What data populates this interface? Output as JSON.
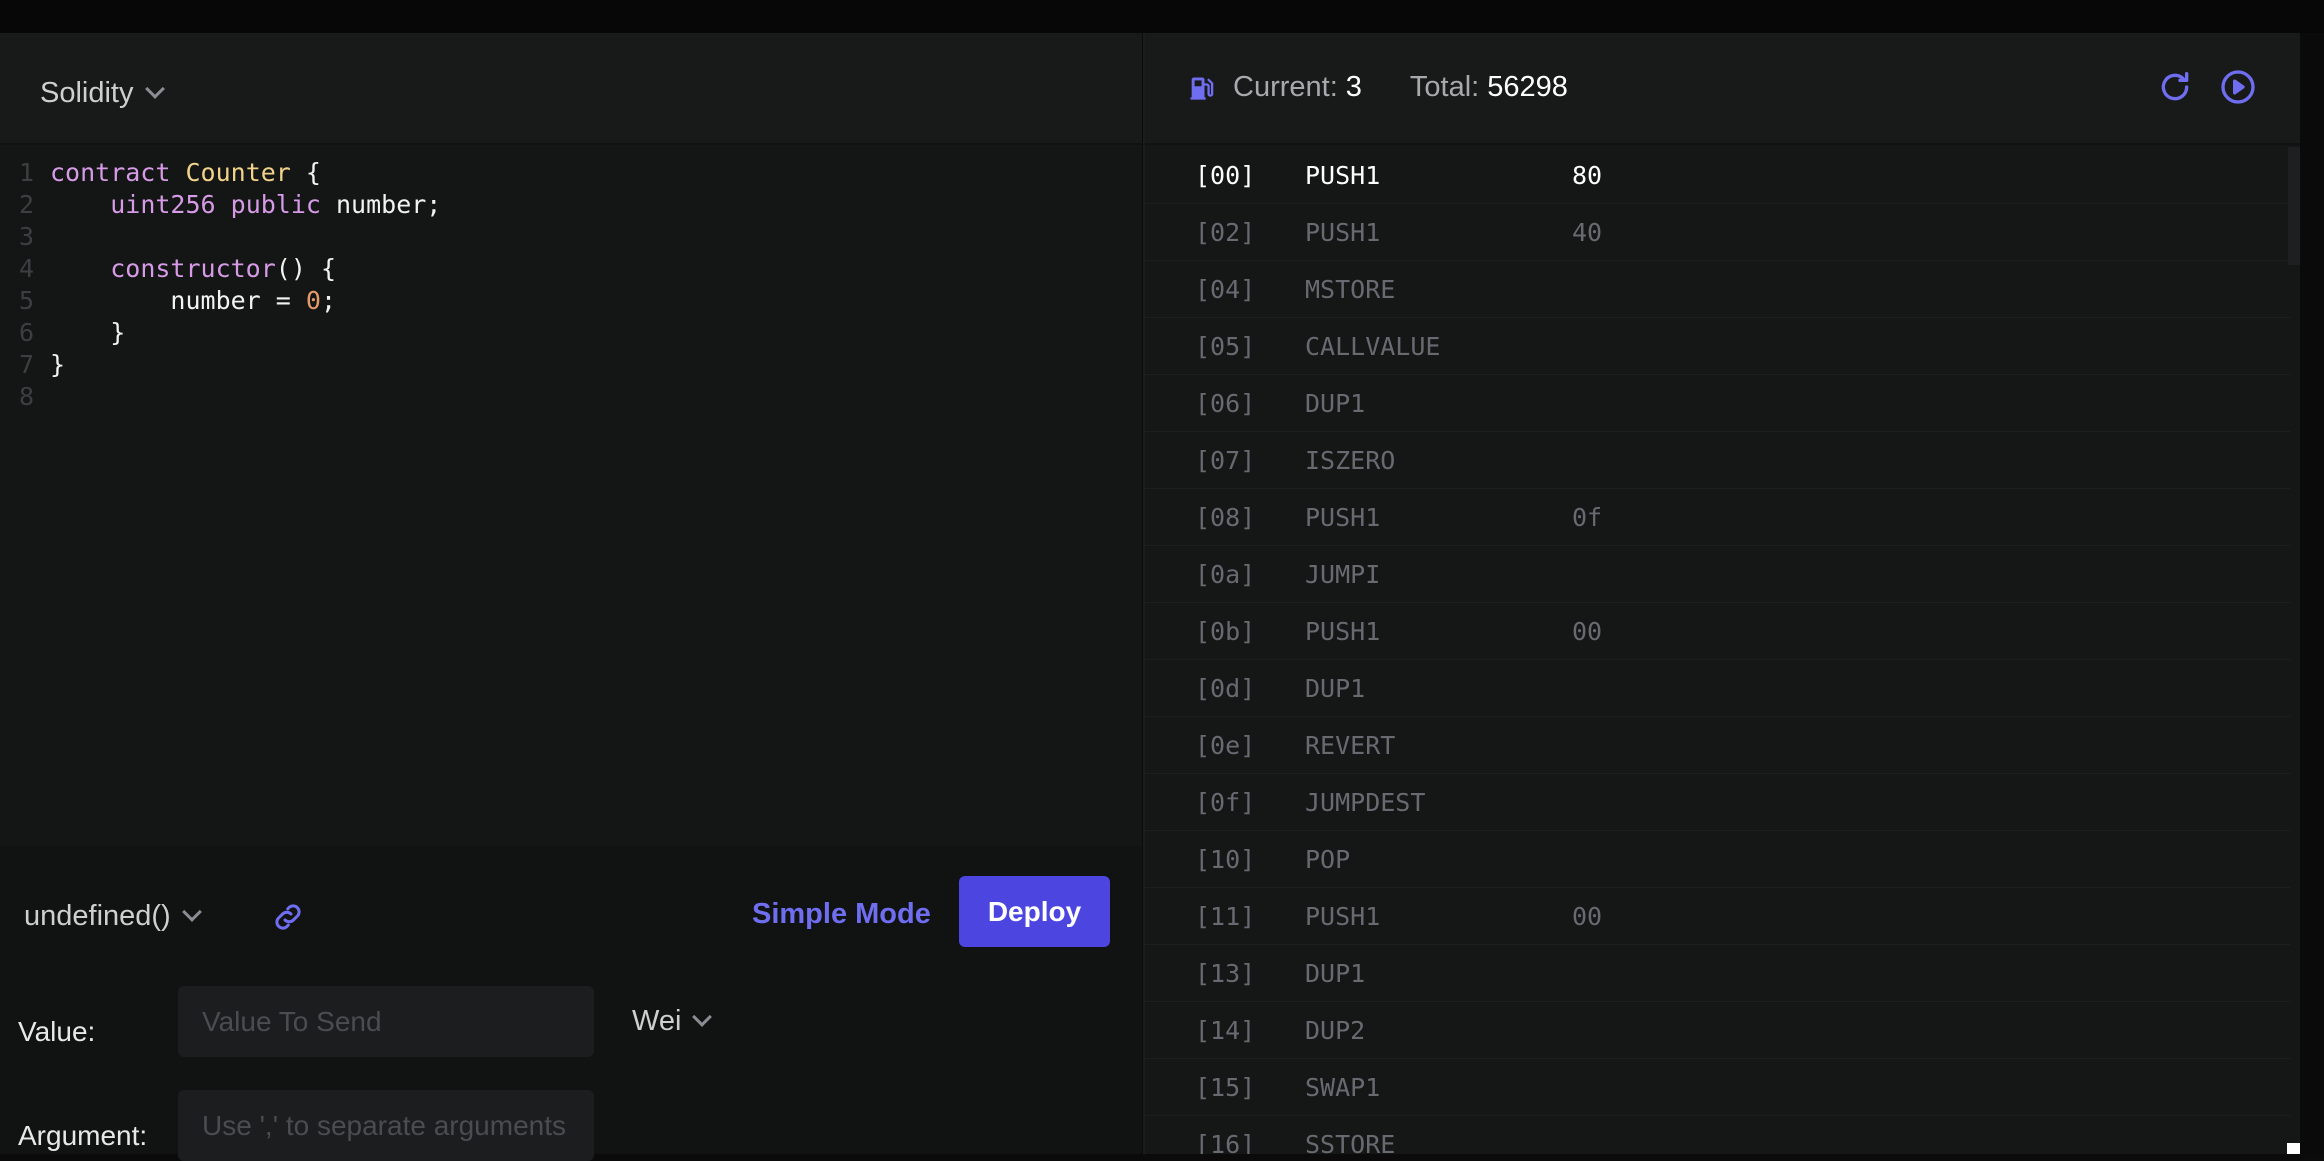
{
  "editor": {
    "language": "Solidity",
    "lines": [
      {
        "n": "1"
      },
      {
        "n": "2"
      },
      {
        "n": "3"
      },
      {
        "n": "4"
      },
      {
        "n": "5"
      },
      {
        "n": "6"
      },
      {
        "n": "7"
      },
      {
        "n": "8"
      }
    ],
    "code": {
      "l1_kw": "contract",
      "l1_name": "Counter",
      "l1_rest": " {",
      "l2_indent": "    ",
      "l2_type": "uint256",
      "l2_sp": " ",
      "l2_kw": "public",
      "l2_rest": " number;",
      "l4_indent": "    ",
      "l4_kw": "constructor",
      "l4_rest": "() {",
      "l5_indent": "        ",
      "l5_pre": "number = ",
      "l5_num": "0",
      "l5_post": ";",
      "l6": "    }",
      "l7": "}"
    }
  },
  "deploy": {
    "method": "undefined()",
    "simple_mode_label": "Simple Mode",
    "deploy_label": "Deploy",
    "value_label": "Value:",
    "value_placeholder": "Value To Send",
    "unit": "Wei",
    "argument_label": "Argument:",
    "argument_placeholder": "Use ',' to separate arguments"
  },
  "gas": {
    "current_label": "Current:",
    "current_value": "3",
    "total_label": "Total:",
    "total_value": "56298"
  },
  "opcodes": [
    {
      "addr": "[00]",
      "op": "PUSH1",
      "val": "80"
    },
    {
      "addr": "[02]",
      "op": "PUSH1",
      "val": "40"
    },
    {
      "addr": "[04]",
      "op": "MSTORE",
      "val": ""
    },
    {
      "addr": "[05]",
      "op": "CALLVALUE",
      "val": ""
    },
    {
      "addr": "[06]",
      "op": "DUP1",
      "val": ""
    },
    {
      "addr": "[07]",
      "op": "ISZERO",
      "val": ""
    },
    {
      "addr": "[08]",
      "op": "PUSH1",
      "val": "0f"
    },
    {
      "addr": "[0a]",
      "op": "JUMPI",
      "val": ""
    },
    {
      "addr": "[0b]",
      "op": "PUSH1",
      "val": "00"
    },
    {
      "addr": "[0d]",
      "op": "DUP1",
      "val": ""
    },
    {
      "addr": "[0e]",
      "op": "REVERT",
      "val": ""
    },
    {
      "addr": "[0f]",
      "op": "JUMPDEST",
      "val": ""
    },
    {
      "addr": "[10]",
      "op": "POP",
      "val": ""
    },
    {
      "addr": "[11]",
      "op": "PUSH1",
      "val": "00"
    },
    {
      "addr": "[13]",
      "op": "DUP1",
      "val": ""
    },
    {
      "addr": "[14]",
      "op": "DUP2",
      "val": ""
    },
    {
      "addr": "[15]",
      "op": "SWAP1",
      "val": ""
    },
    {
      "addr": "[16]",
      "op": "SSTORE",
      "val": ""
    }
  ],
  "icons": {
    "gas": "gas-pump-icon",
    "reset": "reset-icon",
    "run": "run-icon",
    "link": "link-icon",
    "chevron": "chevron-down-icon"
  },
  "colors": {
    "accent": "#4c45e0",
    "link_text": "#6f6ef0",
    "keyword": "#d69ae6",
    "type": "#f0d28a",
    "number": "#e59a6b"
  }
}
